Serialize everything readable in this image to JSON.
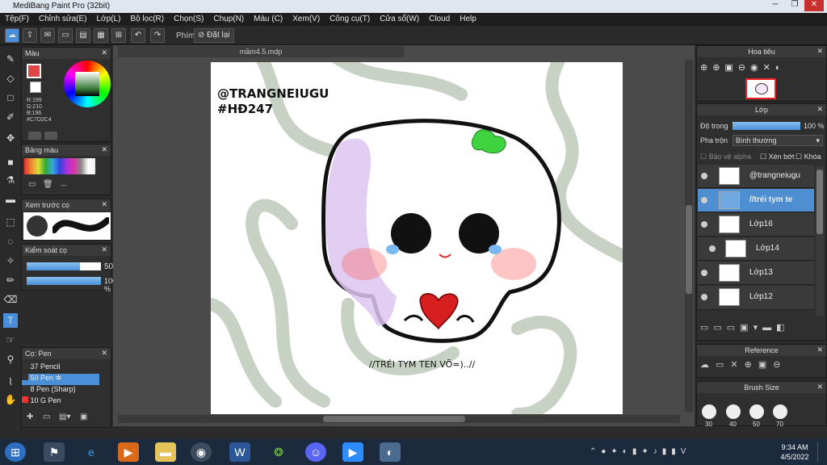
{
  "window": {
    "title": "MediBang Paint Pro (32bit)"
  },
  "menu": [
    "Tệp(F)",
    "Chỉnh sửa(E)",
    "Lớp(L)",
    "Bộ lọc(R)",
    "Chọn(S)",
    "Chụp(N)",
    "Màu (C)",
    "Xem(V)",
    "Công cụ(T)",
    "Cửa sổ(W)",
    "Cloud",
    "Help"
  ],
  "toolbar": {
    "phim_label": "Phím",
    "reset_label": "Đặt lại"
  },
  "color_panel": {
    "title": "Màu",
    "r": "R:199",
    "g": "G:210",
    "b": "B:196",
    "hex": "#C7D2C4"
  },
  "palette_panel": {
    "title": "Bảng màu",
    "dash": "---"
  },
  "preview_panel": {
    "title": "Xem trước cọ"
  },
  "control_panel": {
    "title": "Kiểm soát cọ",
    "size_value": "50",
    "opacity_value": "100 %"
  },
  "brush_panel": {
    "title": "Cọ: Pen",
    "brushes": [
      {
        "size": "37",
        "name": "Pencil"
      },
      {
        "size": "50",
        "name": "Pen"
      },
      {
        "size": "8",
        "name": "Pen (Sharp)"
      },
      {
        "size": "10",
        "name": "G Pen"
      }
    ]
  },
  "document": {
    "tab": "mầm4.5.mdp"
  },
  "artwork": {
    "line1": "@TRANGNEIUGU",
    "line2": "#HĐ247",
    "caption": "//TRÉI TYM TEN VÕ=)..//"
  },
  "navigator_panel": {
    "title": "Hoa tiêu"
  },
  "layer_panel": {
    "title": "Lớp",
    "opacity_label": "Độ trong",
    "opacity_value": "100 %",
    "blend_label": "Pha trộn",
    "blend_value": "Bình thường",
    "protect_alpha": "Bảo vệ alpha",
    "clip": "Xén bớt",
    "lock": "Khóa",
    "layers": [
      "@trangneiugu",
      "//tréi tym te",
      "Lớp16",
      "Lớp14",
      "Lớp13",
      "Lớp12"
    ]
  },
  "reference_panel": {
    "title": "Reference"
  },
  "brushsize_panel": {
    "title": "Brush Size",
    "sizes": [
      "30",
      "40",
      "50",
      "70"
    ]
  },
  "taskbar": {
    "time": "9:34 AM",
    "date": "4/5/2022"
  },
  "colors": {
    "accent": "#4a90d9",
    "selected_layer": "#4d8fd1",
    "mint": "#C7D2C4"
  }
}
